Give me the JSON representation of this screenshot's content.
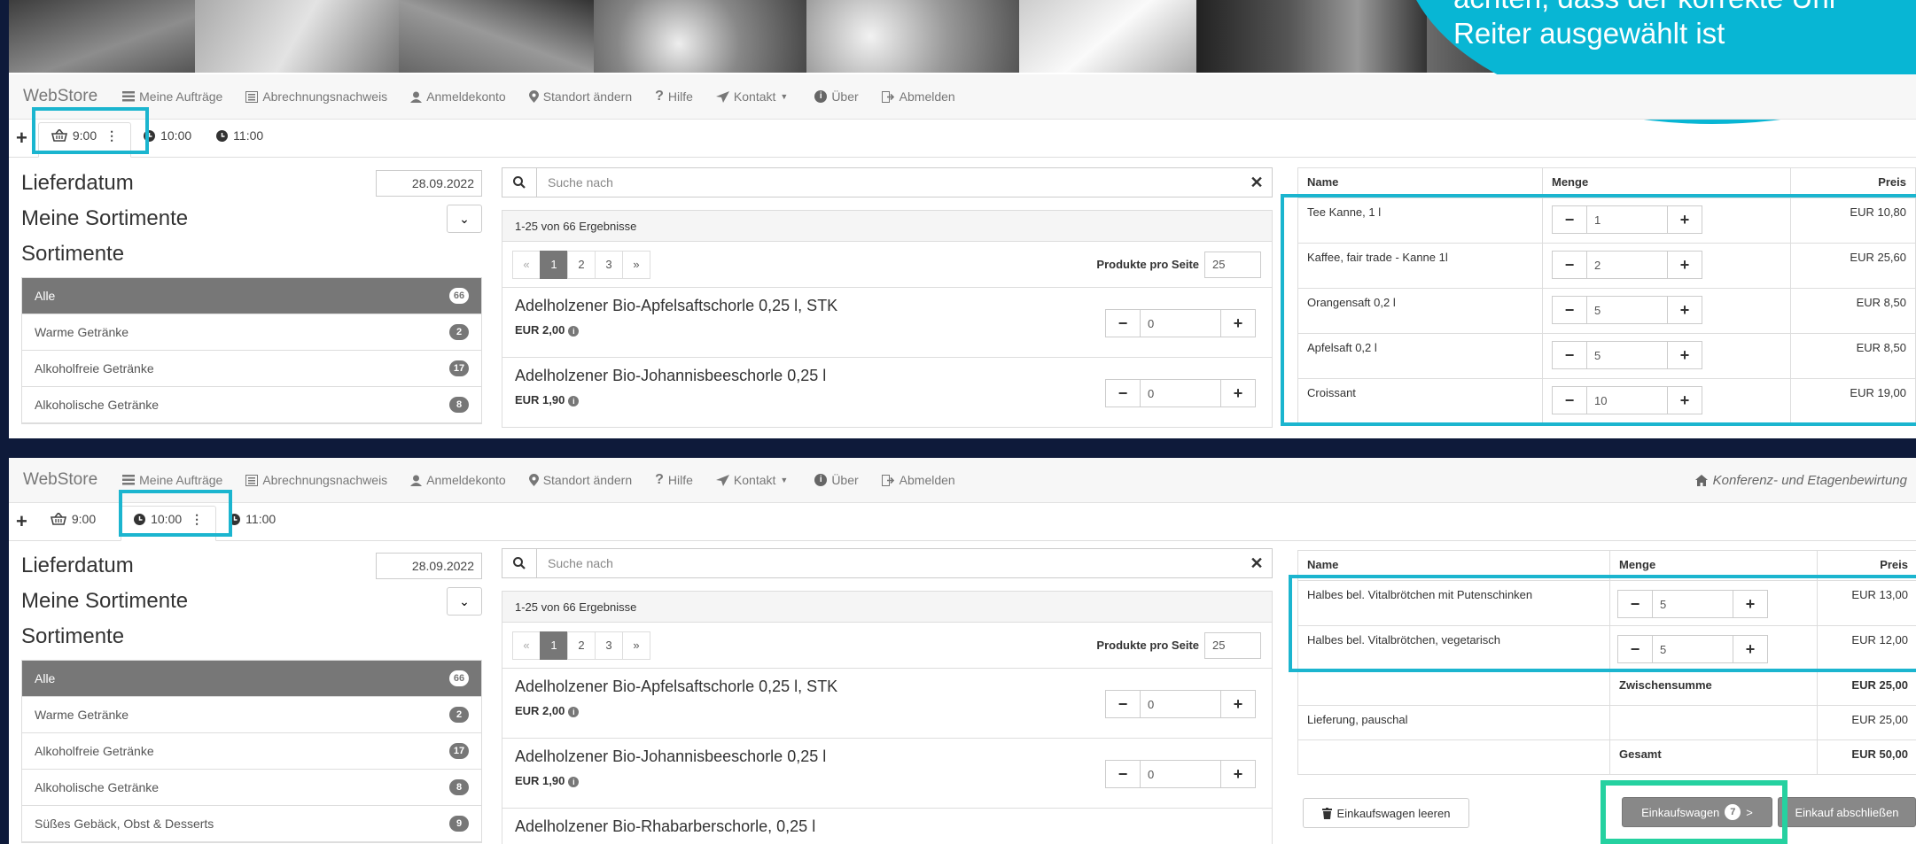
{
  "callout": {
    "line1": "achten, dass der korrekte Uhr",
    "line2": "Reiter ausgewählt ist"
  },
  "nav": {
    "brand": "WebStore",
    "orders": "Meine Aufträge",
    "billing": "Abrechnungsnachweis",
    "account": "Anmeldekonto",
    "location": "Standort ändern",
    "help": "Hilfe",
    "contact": "Kontakt",
    "about": "Über",
    "logout": "Abmelden",
    "location_name": "Konferenz- und Etagenbewirtung"
  },
  "tabs": {
    "add": "+",
    "t1": "9:00",
    "t2": "10:00",
    "t3": "11:00",
    "more": "⋮"
  },
  "left": {
    "delivery_label": "Lieferdatum",
    "delivery_date": "28.09.2022",
    "my_assortments": "Meine Sortimente",
    "assortments": "Sortimente",
    "categories": [
      {
        "label": "Alle",
        "count": "66"
      },
      {
        "label": "Warme Getränke",
        "count": "2"
      },
      {
        "label": "Alkoholfreie Getränke",
        "count": "17"
      },
      {
        "label": "Alkoholische Getränke",
        "count": "8"
      },
      {
        "label": "Süßes Gebäck, Obst & Desserts",
        "count": "9"
      }
    ]
  },
  "mid": {
    "search_placeholder": "Suche nach",
    "results": "1-25 von 66 Ergebnisse",
    "pager": [
      "«",
      "1",
      "2",
      "3",
      "»"
    ],
    "per_page_label": "Produkte pro Seite",
    "per_page": "25",
    "products": [
      {
        "name": "Adelholzener Bio-Apfelsaftschorle 0,25 l, STK",
        "price": "EUR 2,00",
        "qty": "0"
      },
      {
        "name": "Adelholzener Bio-Johannisbeeschorle 0,25 l",
        "price": "EUR 1,90",
        "qty": "0"
      },
      {
        "name": "Adelholzener Bio-Rhabarberschorle, 0,25 l",
        "price": "",
        "qty": ""
      }
    ]
  },
  "cart_top": {
    "head": {
      "name": "Name",
      "qty": "Menge",
      "price": "Preis"
    },
    "rows": [
      {
        "name": "Tee Kanne, 1 l",
        "qty": "1",
        "price": "EUR 10,80"
      },
      {
        "name": "Kaffee, fair trade - Kanne 1l",
        "qty": "2",
        "price": "EUR 25,60"
      },
      {
        "name": "Orangensaft 0,2 l",
        "qty": "5",
        "price": "EUR 8,50"
      },
      {
        "name": "Apfelsaft 0,2 l",
        "qty": "5",
        "price": "EUR 8,50"
      },
      {
        "name": "Croissant",
        "qty": "10",
        "price": "EUR 19,00"
      }
    ]
  },
  "cart_bottom": {
    "head": {
      "name": "Name",
      "qty": "Menge",
      "price": "Preis"
    },
    "rows": [
      {
        "name": "Halbes bel. Vitalbrötchen mit Putenschinken",
        "qty": "5",
        "price": "EUR 13,00"
      },
      {
        "name": "Halbes bel. Vitalbrötchen, vegetarisch",
        "qty": "5",
        "price": "EUR 12,00"
      }
    ],
    "subtotal_label": "Zwischensumme",
    "subtotal": "EUR 25,00",
    "delivery_label": "Lieferung, pauschal",
    "delivery": "EUR 25,00",
    "total_label": "Gesamt",
    "total": "EUR 50,00",
    "empty_btn": "Einkaufswagen leeren",
    "cart_btn": "Einkaufswagen",
    "cart_count": "7",
    "cart_arrow": ">",
    "checkout_btn": "Einkauf abschließen"
  },
  "colors": {
    "highlight": "#1bb5cf",
    "highlight_green": "#25d1a0",
    "callout": "#08b6d4",
    "background": "#0e1a3a"
  }
}
